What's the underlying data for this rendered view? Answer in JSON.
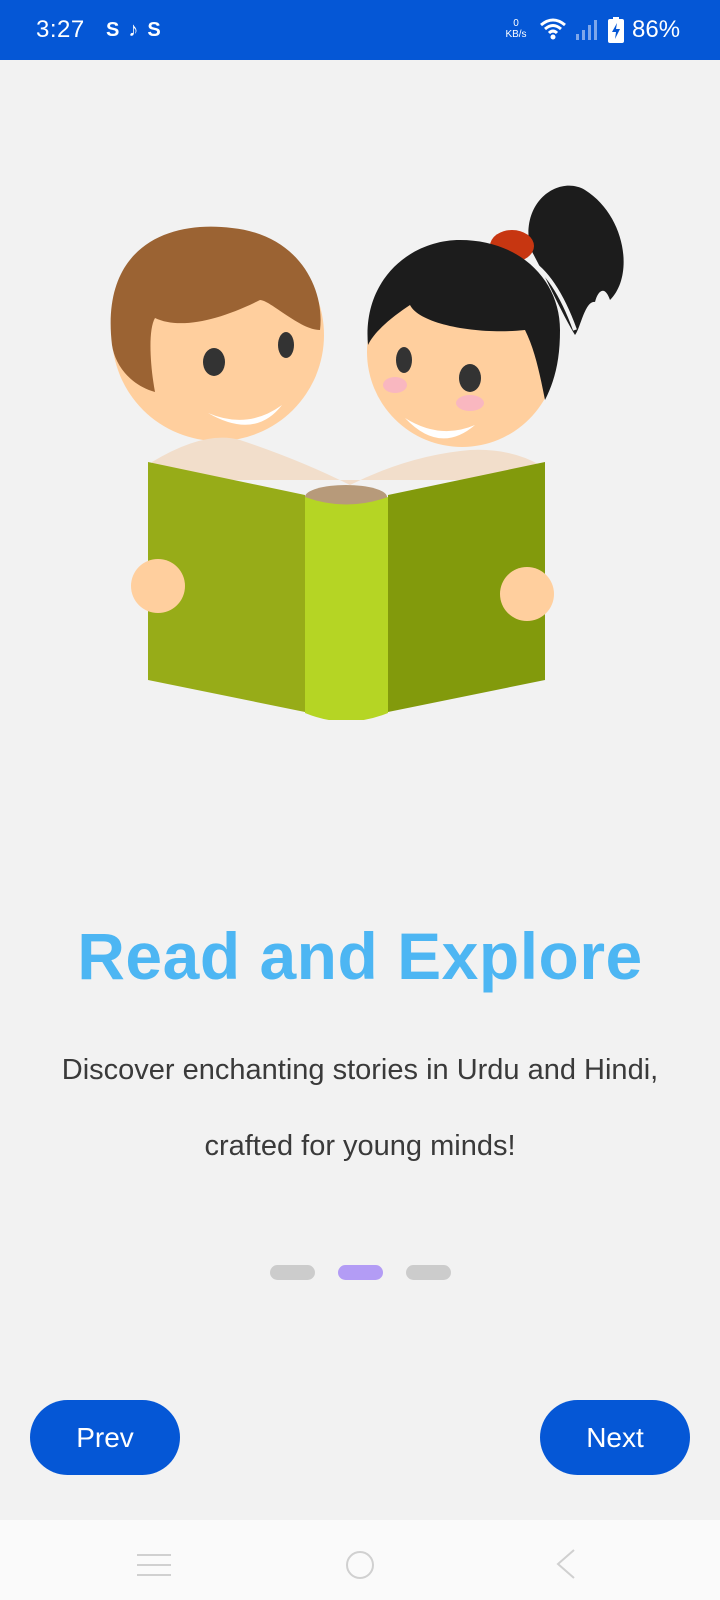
{
  "status_bar": {
    "time": "3:27",
    "notifications": [
      "S",
      "♪",
      "S"
    ],
    "net_speed_value": "0",
    "net_speed_unit": "KB/s",
    "battery": "86%",
    "background": "#0557d6"
  },
  "onboarding": {
    "title": "Read and Explore",
    "description": "Discover enchanting stories in Urdu and Hindi, crafted for young minds!",
    "page_indicator": {
      "total": 3,
      "active_index": 1
    },
    "title_color": "#4db6f3",
    "accent_color": "#0557d6"
  },
  "buttons": {
    "prev_label": "Prev",
    "next_label": "Next"
  },
  "nav_bar": {
    "menu_icon": "menu-icon",
    "home_icon": "home-icon",
    "back_icon": "back-icon"
  }
}
